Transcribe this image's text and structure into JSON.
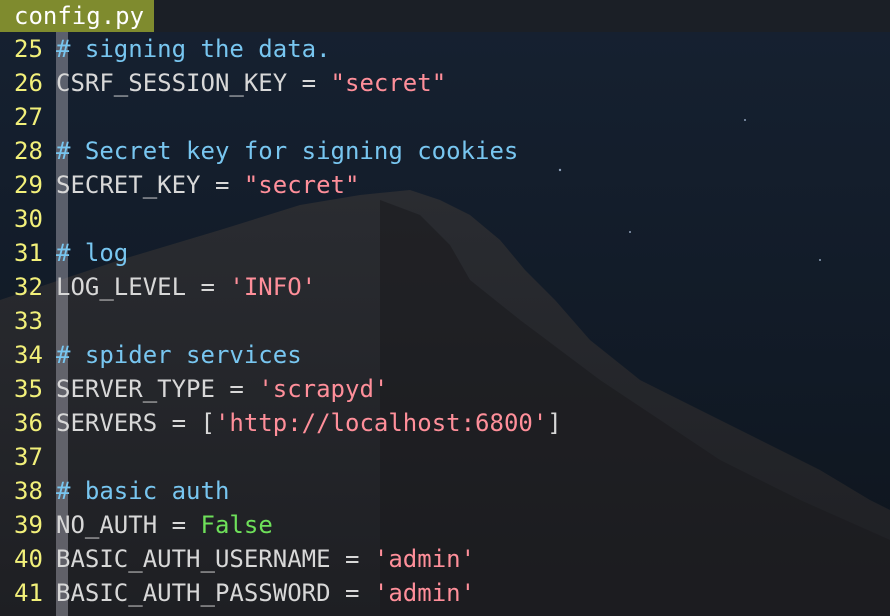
{
  "tab": {
    "filename": "config.py"
  },
  "colors": {
    "line_number": "#f2f07a",
    "comment": "#78c6f0",
    "identifier": "#d8d8d8",
    "string": "#ff8f9a",
    "constant": "#6ee05a",
    "tab_background": "#7f8b2e"
  },
  "lines": [
    {
      "number": "25",
      "tokens": [
        {
          "type": "comment",
          "text": "# signing the data."
        }
      ]
    },
    {
      "number": "26",
      "tokens": [
        {
          "type": "ident",
          "text": "CSRF_SESSION_KEY"
        },
        {
          "type": "op",
          "text": " = "
        },
        {
          "type": "string",
          "text": "\"secret\""
        }
      ]
    },
    {
      "number": "27",
      "tokens": []
    },
    {
      "number": "28",
      "tokens": [
        {
          "type": "comment",
          "text": "# Secret key for signing cookies"
        }
      ]
    },
    {
      "number": "29",
      "tokens": [
        {
          "type": "ident",
          "text": "SECRET_KEY"
        },
        {
          "type": "op",
          "text": " = "
        },
        {
          "type": "string",
          "text": "\"secret\""
        }
      ]
    },
    {
      "number": "30",
      "tokens": []
    },
    {
      "number": "31",
      "tokens": [
        {
          "type": "comment",
          "text": "# log"
        }
      ]
    },
    {
      "number": "32",
      "tokens": [
        {
          "type": "ident",
          "text": "LOG_LEVEL"
        },
        {
          "type": "op",
          "text": " = "
        },
        {
          "type": "string",
          "text": "'INFO'"
        }
      ]
    },
    {
      "number": "33",
      "tokens": []
    },
    {
      "number": "34",
      "tokens": [
        {
          "type": "comment",
          "text": "# spider services"
        }
      ]
    },
    {
      "number": "35",
      "tokens": [
        {
          "type": "ident",
          "text": "SERVER_TYPE"
        },
        {
          "type": "op",
          "text": " = "
        },
        {
          "type": "string",
          "text": "'scrapyd'"
        }
      ]
    },
    {
      "number": "36",
      "tokens": [
        {
          "type": "ident",
          "text": "SERVERS"
        },
        {
          "type": "op",
          "text": " = ["
        },
        {
          "type": "string",
          "text": "'http://localhost:6800'"
        },
        {
          "type": "op",
          "text": "]"
        }
      ]
    },
    {
      "number": "37",
      "tokens": []
    },
    {
      "number": "38",
      "tokens": [
        {
          "type": "comment",
          "text": "# basic auth"
        }
      ]
    },
    {
      "number": "39",
      "tokens": [
        {
          "type": "ident",
          "text": "NO_AUTH"
        },
        {
          "type": "op",
          "text": " = "
        },
        {
          "type": "const",
          "text": "False"
        }
      ]
    },
    {
      "number": "40",
      "tokens": [
        {
          "type": "ident",
          "text": "BASIC_AUTH_USERNAME"
        },
        {
          "type": "op",
          "text": " = "
        },
        {
          "type": "string",
          "text": "'admin'"
        }
      ]
    },
    {
      "number": "41",
      "tokens": [
        {
          "type": "ident",
          "text": "BASIC_AUTH_PASSWORD"
        },
        {
          "type": "op",
          "text": " = "
        },
        {
          "type": "string",
          "text": "'admin'"
        }
      ]
    }
  ]
}
